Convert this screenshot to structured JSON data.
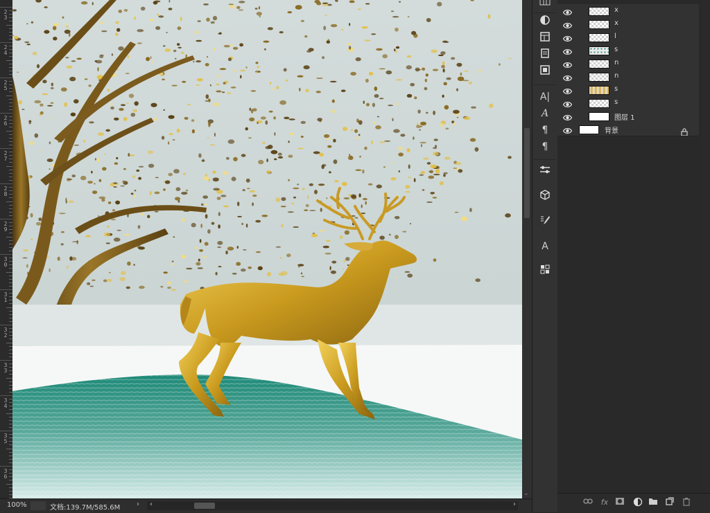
{
  "ruler": {
    "labels": [
      "2\n3",
      "2\n4",
      "2\n5",
      "2\n6",
      "2\n7",
      "2\n8",
      "2\n9",
      "3\n0",
      "3\n1",
      "3\n2",
      "3\n3",
      "3\n4",
      "3\n5",
      "3\n6"
    ]
  },
  "status": {
    "zoom": "100%",
    "doc_info": "文档:139.7M/585.6M",
    "arrow_right": "›",
    "arrow_left": "‹"
  },
  "toolstrip": {
    "icons": [
      "grid-icon",
      "adjustments-icon",
      "properties-icon",
      "notes-icon",
      "navigator-icon",
      "character-icon",
      "glyphs-icon",
      "paragraph-styles-icon",
      "paragraph-icon",
      "brush-settings-icon",
      "3d-icon",
      "brushes-icon",
      "character-styles-icon",
      "libraries-icon"
    ],
    "char_a": "A|",
    "char_script": "A",
    "paragraph": "¶",
    "para_styles": "¶",
    "char_styles": "A"
  },
  "layers": [
    {
      "name": "x",
      "thumb": "transparent",
      "visible": true
    },
    {
      "name": "x",
      "thumb": "transparent",
      "visible": true
    },
    {
      "name": "l",
      "thumb": "transparent",
      "visible": true
    },
    {
      "name": "s",
      "thumb": "dots",
      "visible": true
    },
    {
      "name": "n",
      "thumb": "transparent",
      "visible": true
    },
    {
      "name": "n",
      "thumb": "transparent",
      "visible": true
    },
    {
      "name": "s",
      "thumb": "gold",
      "visible": true
    },
    {
      "name": "s",
      "thumb": "transparent",
      "visible": true
    },
    {
      "name": "图层 1",
      "thumb": "solid",
      "visible": true
    },
    {
      "name": "背景",
      "thumb": "solid",
      "visible": true,
      "locked": true
    }
  ],
  "layer_footer": {
    "icons": [
      "link-layers-icon",
      "fx-icon",
      "add-mask-icon",
      "adjustment-layer-icon",
      "new-group-icon",
      "new-layer-icon",
      "delete-layer-icon"
    ],
    "fx": "fx"
  },
  "colors": {
    "gold": "#c9a22a",
    "teal": "#2f8f80",
    "snow": "#f4f6f5",
    "sky": "#cfd8d7"
  }
}
